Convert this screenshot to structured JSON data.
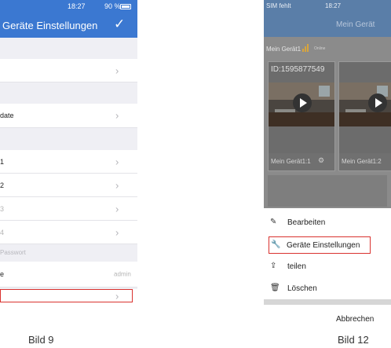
{
  "left": {
    "status": {
      "time": "18:27",
      "battery": "90 %"
    },
    "nav": {
      "title": "Geräte Einstellungen",
      "confirm_icon": "checkmark-icon"
    },
    "rows": [
      {
        "label": "date"
      },
      {
        "label": "1"
      },
      {
        "label": "2"
      },
      {
        "label": "3"
      },
      {
        "label": "4"
      },
      {
        "label": "e",
        "value": "admin"
      }
    ],
    "section_password": "Passwort",
    "caption": "Bild 9"
  },
  "right": {
    "status": {
      "sim": "SIM fehlt",
      "time": "18:27"
    },
    "nav": {
      "title": "Mein Gerät"
    },
    "device": {
      "title": "Mein Gerät1",
      "online": "Online"
    },
    "cards": [
      {
        "id": "ID:1595877549",
        "name": "Mein Gerät1:1"
      },
      {
        "name": "Mein Gerät1:2"
      }
    ],
    "sheet": {
      "items": [
        {
          "label": "Bearbeiten",
          "icon": "pencil-icon"
        },
        {
          "label": "Geräte Einstellungen",
          "icon": "wrench-icon"
        },
        {
          "label": "teilen",
          "icon": "share-icon"
        },
        {
          "label": "Löschen",
          "icon": "trash-icon"
        }
      ],
      "cancel": "Abbrechen"
    },
    "caption": "Bild 12"
  },
  "colors": {
    "nav_blue": "#3b78d1",
    "highlight_red": "#d9322f"
  }
}
